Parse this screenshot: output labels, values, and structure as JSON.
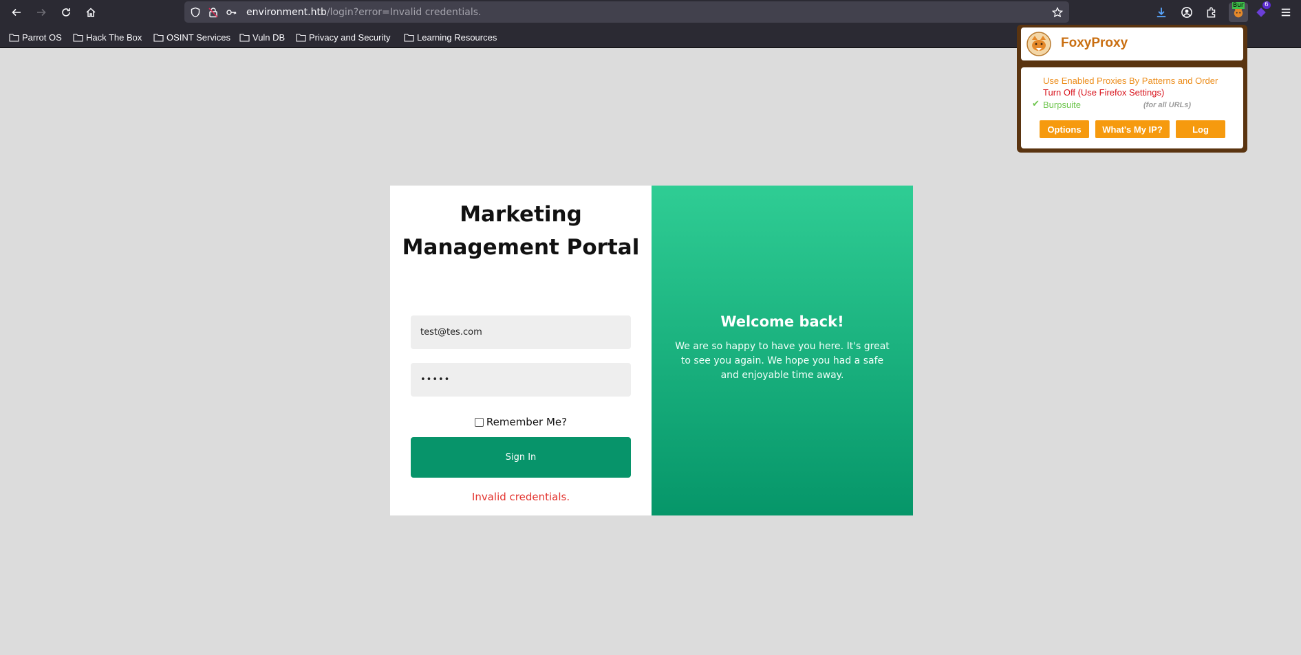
{
  "browser": {
    "url_host": "environment.htb",
    "url_path": "/login?error=Invalid credentials.",
    "burp_badge": "Bur",
    "ext_badge_count": "6",
    "bookmarks": [
      {
        "label": "Parrot OS"
      },
      {
        "label": "Hack The Box"
      },
      {
        "label": "OSINT Services"
      },
      {
        "label": "Vuln DB"
      },
      {
        "label": "Privacy and Security"
      },
      {
        "label": "Learning Resources"
      }
    ]
  },
  "login": {
    "title": "Marketing Management Portal",
    "email_value": "test@tes.com",
    "password_value": "•••••",
    "remember_label": "Remember Me?",
    "signin_label": "Sign In",
    "error": "Invalid credentials."
  },
  "welcome": {
    "title": "Welcome back!",
    "text": "We are so happy to have you here. It's great to see you again. We hope you had a safe and enjoyable time away."
  },
  "foxyproxy": {
    "title": "FoxyProxy",
    "mode": "Use Enabled Proxies By Patterns and Order",
    "turn_off": "Turn Off (Use Firefox Settings)",
    "proxy_name": "Burpsuite",
    "proxy_scope": "(for all URLs)",
    "buttons": {
      "options": "Options",
      "whats_my_ip": "What's My IP?",
      "log": "Log"
    }
  },
  "colors": {
    "accent_green": "#07946a",
    "error_red": "#e3342f",
    "foxy_orange": "#f69a0e"
  }
}
